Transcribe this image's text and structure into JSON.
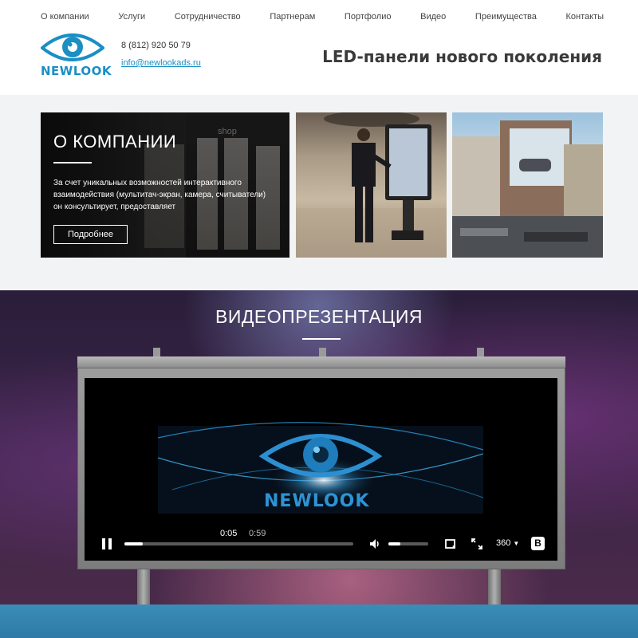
{
  "nav": {
    "items": [
      "О компании",
      "Услуги",
      "Сотрудничество",
      "Партнерам",
      "Портфолио",
      "Видео",
      "Преимущества",
      "Контакты"
    ]
  },
  "header": {
    "logo_text": "NEWLOOK",
    "phone": "8 (812) 920 50 79",
    "email": "info@newlookads.ru",
    "tagline": "LED-панели нового поколения"
  },
  "about": {
    "title": "О КОМПАНИИ",
    "text": "За счет уникальных возможностей интерактивного взаимодействия (мультитач-экран, камера, считыватели) он консультирует, предоставляет",
    "button": "Подробнее",
    "shop_sign": "shop"
  },
  "video": {
    "title": "ВИДЕОПРЕЗЕНТАЦИЯ",
    "logo_text": "NEWLOOK",
    "time_current": "0:05",
    "time_total": "0:59",
    "quality": "360",
    "progress": 0.08,
    "volume": 0.3
  },
  "colors": {
    "accent": "#1a8fc4",
    "band": "#f2f3f5",
    "bottom": "#2f7aa6"
  }
}
